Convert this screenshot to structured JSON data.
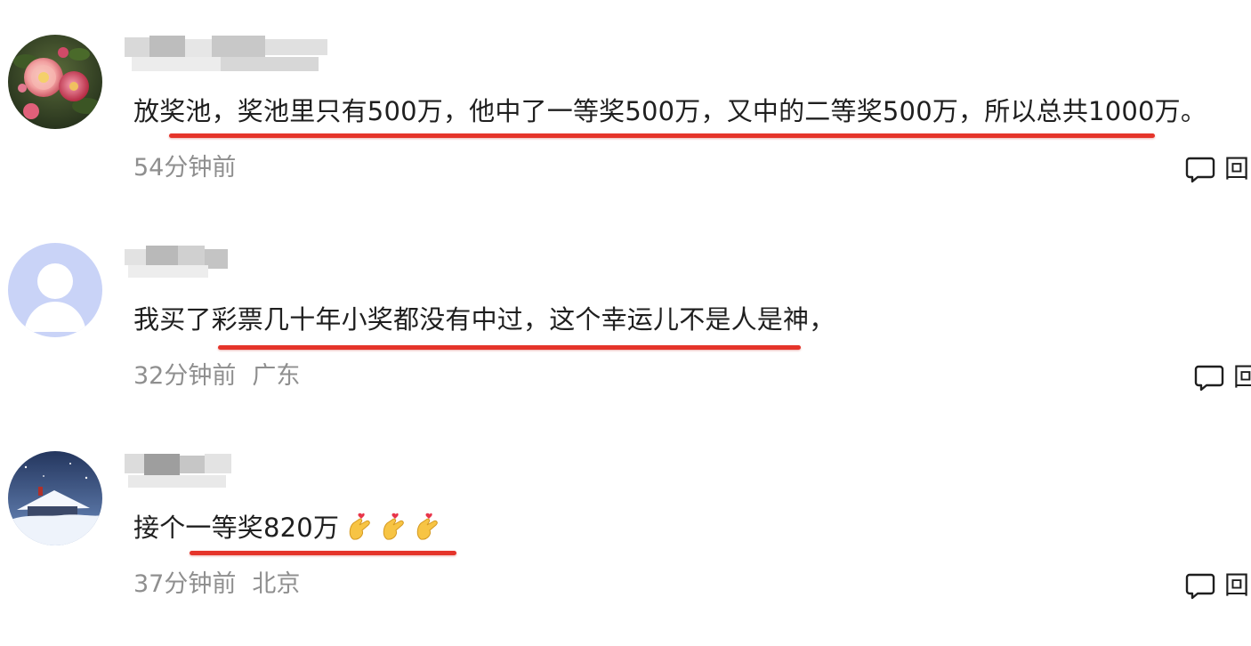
{
  "comments": [
    {
      "text": "放奖池，奖池里只有500万，他中了一等奖500万，又中的二等奖500万，所以总共1000万。",
      "time": "54分钟前",
      "location": "",
      "reply_label": "回",
      "avatar": "flower-avatar"
    },
    {
      "text": "我买了彩票几十年小奖都没有中过，这个幸运儿不是人是神，",
      "time": "32分钟前",
      "location": "广东",
      "reply_label": "回",
      "avatar": "default-user-avatar"
    },
    {
      "text": "接个一等奖820万",
      "emojis": [
        "finger-heart-emoji",
        "finger-heart-emoji",
        "finger-heart-emoji"
      ],
      "time": "37分钟前",
      "location": "北京",
      "reply_label": "回",
      "avatar": "snow-house-avatar"
    }
  ],
  "colors": {
    "underline": "#e5342a",
    "meta_text": "#8f8f8f",
    "body_text": "#1f1f1f",
    "default_avatar_bg": "#c9d3f7"
  }
}
